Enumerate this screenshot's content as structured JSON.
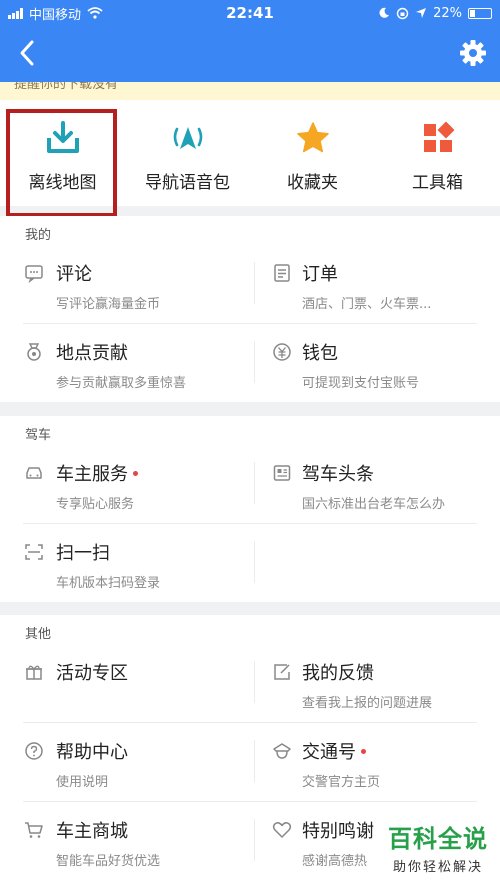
{
  "status_bar": {
    "carrier": "中国移动",
    "time": "22:41",
    "battery": "22%"
  },
  "notice": {
    "text": "提醒你的下载没有"
  },
  "quick_actions": [
    {
      "label": "离线地图",
      "icon": "download-map-icon"
    },
    {
      "label": "导航语音包",
      "icon": "navigation-voice-icon"
    },
    {
      "label": "收藏夹",
      "icon": "star-icon"
    },
    {
      "label": "工具箱",
      "icon": "toolbox-icon"
    }
  ],
  "sections": {
    "mine": {
      "title": "我的",
      "items": [
        {
          "title": "评论",
          "subtitle": "写评论赢海量金币",
          "icon": "comment-icon"
        },
        {
          "title": "订单",
          "subtitle": "酒店、门票、火车票...",
          "icon": "order-icon"
        },
        {
          "title": "地点贡献",
          "subtitle": "参与贡献赢取多重惊喜",
          "icon": "medal-icon"
        },
        {
          "title": "钱包",
          "subtitle": "可提现到支付宝账号",
          "icon": "wallet-icon"
        }
      ]
    },
    "driving": {
      "title": "驾车",
      "items": [
        {
          "title": "车主服务",
          "subtitle": "专享贴心服务",
          "icon": "car-icon"
        },
        {
          "title": "驾车头条",
          "subtitle": "国六标准出台老车怎么办",
          "icon": "news-icon"
        },
        {
          "title": "扫一扫",
          "subtitle": "车机版本扫码登录",
          "icon": "scan-icon"
        }
      ]
    },
    "other": {
      "title": "其他",
      "items": [
        {
          "title": "活动专区",
          "subtitle": "",
          "icon": "gift-icon"
        },
        {
          "title": "我的反馈",
          "subtitle": "查看我上报的问题进展",
          "icon": "feedback-icon"
        },
        {
          "title": "帮助中心",
          "subtitle": "使用说明",
          "icon": "help-icon"
        },
        {
          "title": "交通号",
          "subtitle": "交警官方主页",
          "icon": "police-icon"
        },
        {
          "title": "车主商城",
          "subtitle": "智能车品好货优选",
          "icon": "cart-icon"
        },
        {
          "title": "特别鸣谢",
          "subtitle": "感谢高德热",
          "icon": "heart-icon"
        }
      ]
    }
  },
  "watermark": {
    "title": "百科全说",
    "subtitle": "助你轻松解决"
  },
  "colors": {
    "header": "#3a86f4",
    "accent_teal": "#1fa2b5",
    "red_dot": "#e64545",
    "highlight": "#b51f1f"
  }
}
